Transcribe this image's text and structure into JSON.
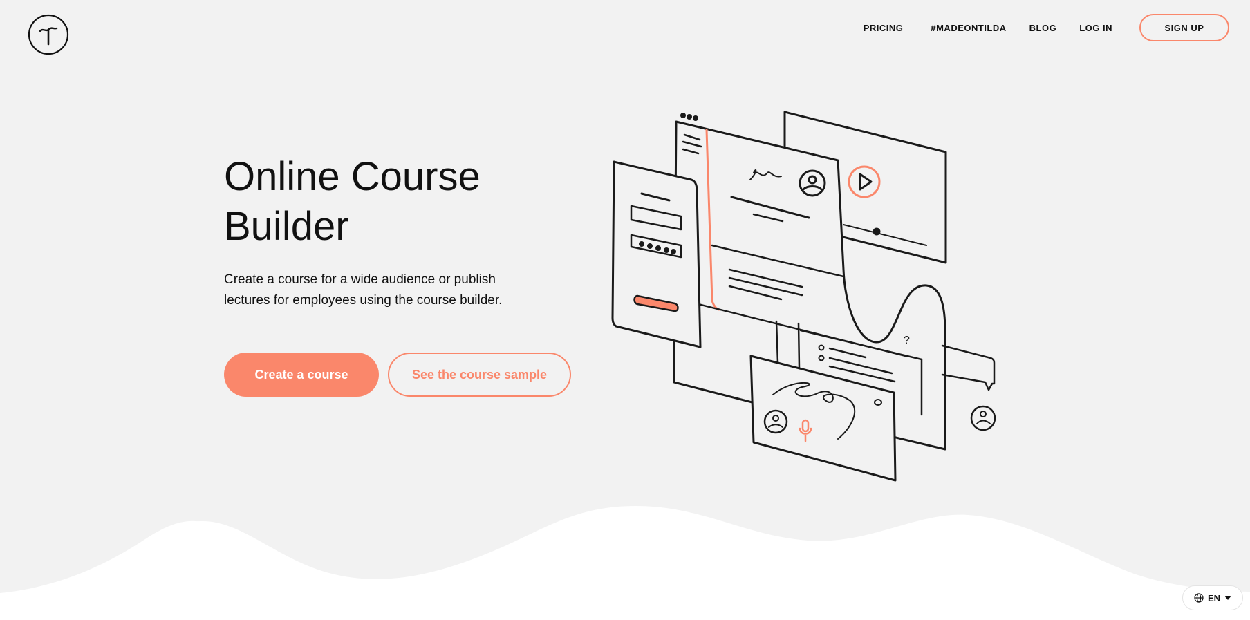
{
  "nav": {
    "items": [
      "PRICING",
      "#MADEONTILDA",
      "BLOG",
      "LOG IN"
    ],
    "signup_label": "SIGN UP"
  },
  "hero": {
    "title": "Online Course Builder",
    "description": "Create a course for a wide audience or publish lectures for employees using the course builder.",
    "primary_button": "Create a course",
    "secondary_button": "See the course sample"
  },
  "lang": {
    "code": "EN",
    "icon": "globe-icon"
  },
  "illustration": {
    "question_mark": "?"
  },
  "colors": {
    "accent": "#fa876b",
    "background": "#f2f2f2",
    "text": "#111111"
  }
}
